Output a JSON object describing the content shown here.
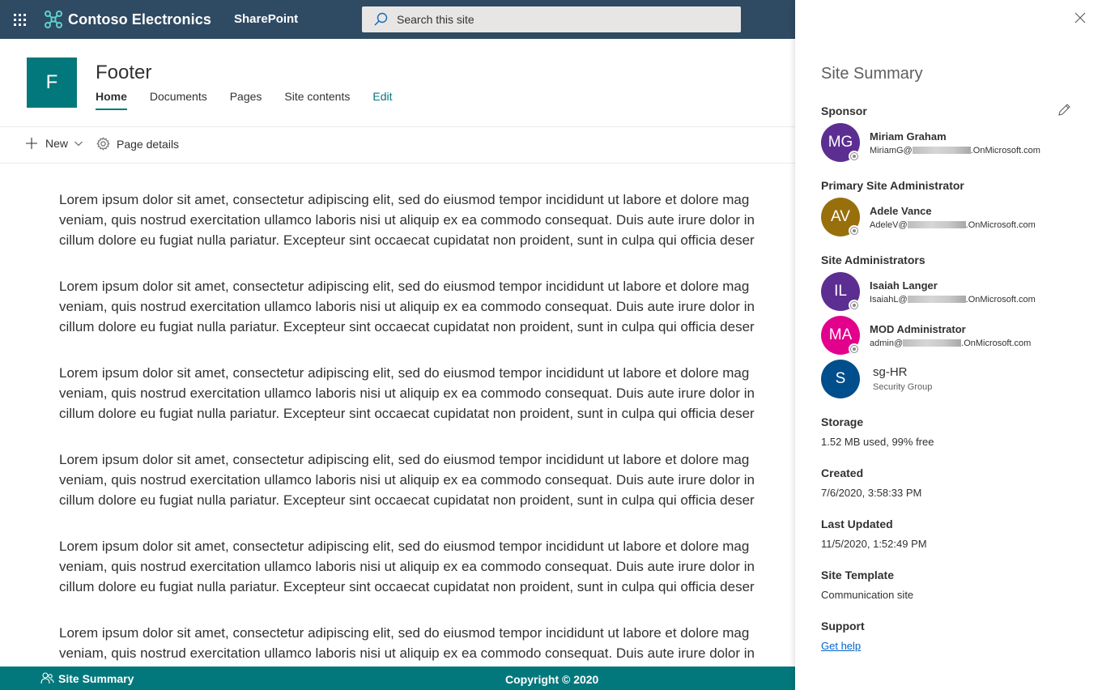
{
  "suitebar": {
    "brand_name": "Contoso Electronics",
    "app_name": "SharePoint",
    "search_placeholder": "Search this site",
    "bg_color": "#2f4a63"
  },
  "site": {
    "logo_letter": "F",
    "title": "Footer",
    "theme_color": "#03787c",
    "nav": [
      {
        "label": "Home",
        "active": true
      },
      {
        "label": "Documents"
      },
      {
        "label": "Pages"
      },
      {
        "label": "Site contents"
      },
      {
        "label": "Edit"
      }
    ]
  },
  "commandbar": {
    "new_label": "New",
    "page_details_label": "Page details"
  },
  "content": {
    "paragraph_lines": [
      "Lorem ipsum dolor sit amet, consectetur adipiscing elit, sed do eiusmod tempor incididunt ut labore et dolore mag",
      "veniam, quis nostrud exercitation ullamco laboris nisi ut aliquip ex ea commodo consequat. Duis aute irure dolor in",
      "cillum dolore eu fugiat nulla pariatur. Excepteur sint occaecat cupidatat non proident, sunt in culpa qui officia deser"
    ],
    "paragraph_count": 6
  },
  "footer": {
    "site_summary_label": "Site Summary",
    "copyright": "Copyright © 2020"
  },
  "panel": {
    "title": "Site Summary",
    "sponsor": {
      "label": "Sponsor",
      "person": {
        "initials": "MG",
        "name": "Miriam Graham",
        "email_prefix": "MiriamG@",
        "email_suffix": ".OnMicrosoft.com",
        "color": "#5c2e91"
      }
    },
    "primary_admin": {
      "label": "Primary Site Administrator",
      "person": {
        "initials": "AV",
        "name": "Adele Vance",
        "email_prefix": "AdeleV@",
        "email_suffix": ".OnMicrosoft.com",
        "color": "#986f0b"
      }
    },
    "site_admins": {
      "label": "Site Administrators",
      "people": [
        {
          "initials": "IL",
          "name": "Isaiah Langer",
          "email_prefix": "IsaiahL@",
          "email_suffix": ".OnMicrosoft.com",
          "color": "#5c2e91"
        },
        {
          "initials": "MA",
          "name": "MOD Administrator",
          "email_prefix": "admin@",
          "email_suffix": ".OnMicrosoft.com",
          "color": "#e3008c"
        }
      ],
      "group": {
        "initials": "S",
        "name": "sg-HR",
        "type": "Security Group",
        "color": "#004e8c"
      }
    },
    "storage": {
      "label": "Storage",
      "value": "1.52 MB used, 99% free"
    },
    "created": {
      "label": "Created",
      "value": "7/6/2020, 3:58:33 PM"
    },
    "last_updated": {
      "label": "Last Updated",
      "value": "11/5/2020, 1:52:49 PM"
    },
    "site_template": {
      "label": "Site Template",
      "value": "Communication site"
    },
    "support": {
      "label": "Support",
      "link": "Get help"
    }
  }
}
